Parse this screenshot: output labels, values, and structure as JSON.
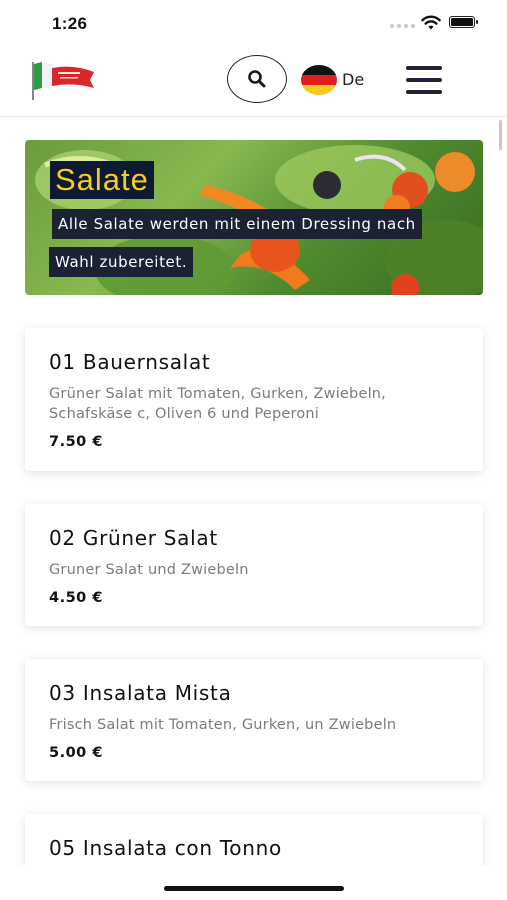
{
  "status_bar": {
    "time": "1:26"
  },
  "header": {
    "logo_icon": "restaurant-logo-flag-icon",
    "search_icon": "search-icon",
    "language": "De",
    "flag_icon": "german-flag-icon",
    "menu_icon": "hamburger-menu-icon"
  },
  "banner": {
    "title": "Salate",
    "description_line1": "Alle Salate werden mit einem Dressing nach",
    "description_line2": "Wahl zubereitet."
  },
  "items": [
    {
      "title": "01 Bauernsalat",
      "description": "Grüner Salat mit Tomaten, Gurken, Zwiebeln, Schafskäse c, Oliven 6 und Peperoni",
      "price": "7.50 €"
    },
    {
      "title": "02 Grüner Salat",
      "description": "Gruner Salat und Zwiebeln",
      "price": "4.50 €"
    },
    {
      "title": "03 Insalata Mista",
      "description": "Frisch Salat mit Tomaten, Gurken, un Zwiebeln",
      "price": "5.00 €"
    },
    {
      "title": "05 Insalata con Tonno"
    }
  ],
  "colors": {
    "banner_title_text": "#f6cd1e",
    "banner_title_bg": "#0e1932",
    "menu_icon": "#1c2238",
    "description_text": "#7b7b7b"
  }
}
